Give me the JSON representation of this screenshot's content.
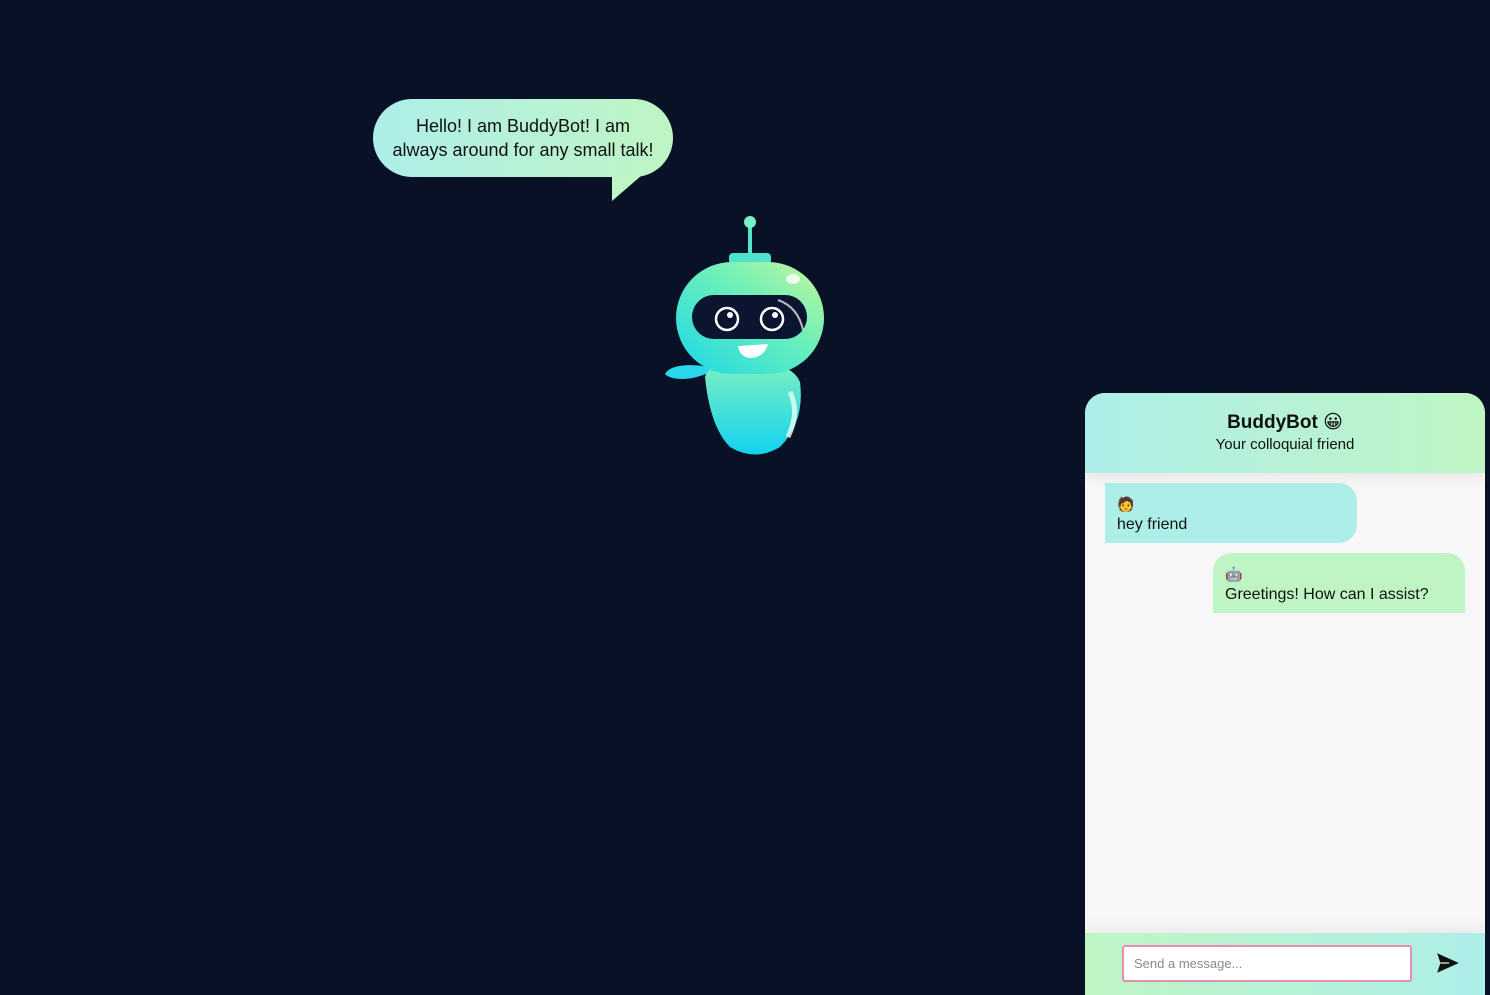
{
  "speech_bubble": {
    "text": "Hello! I am BuddyBot! I am always around for any small talk!"
  },
  "chat": {
    "title": "BuddyBot 😀",
    "subtitle": "Your colloquial friend",
    "messages": [
      {
        "sender": "user",
        "avatar": "🧑",
        "text": "hey friend"
      },
      {
        "sender": "bot",
        "avatar": "🤖",
        "text": "Greetings! How can I assist?"
      }
    ],
    "input": {
      "placeholder": "Send a message...",
      "value": ""
    },
    "send_icon": "send-icon"
  },
  "colors": {
    "background": "#091126",
    "bubble_cyan": "#aeeee9",
    "bubble_green": "#bff5c4",
    "input_border": "#e38fb0"
  }
}
